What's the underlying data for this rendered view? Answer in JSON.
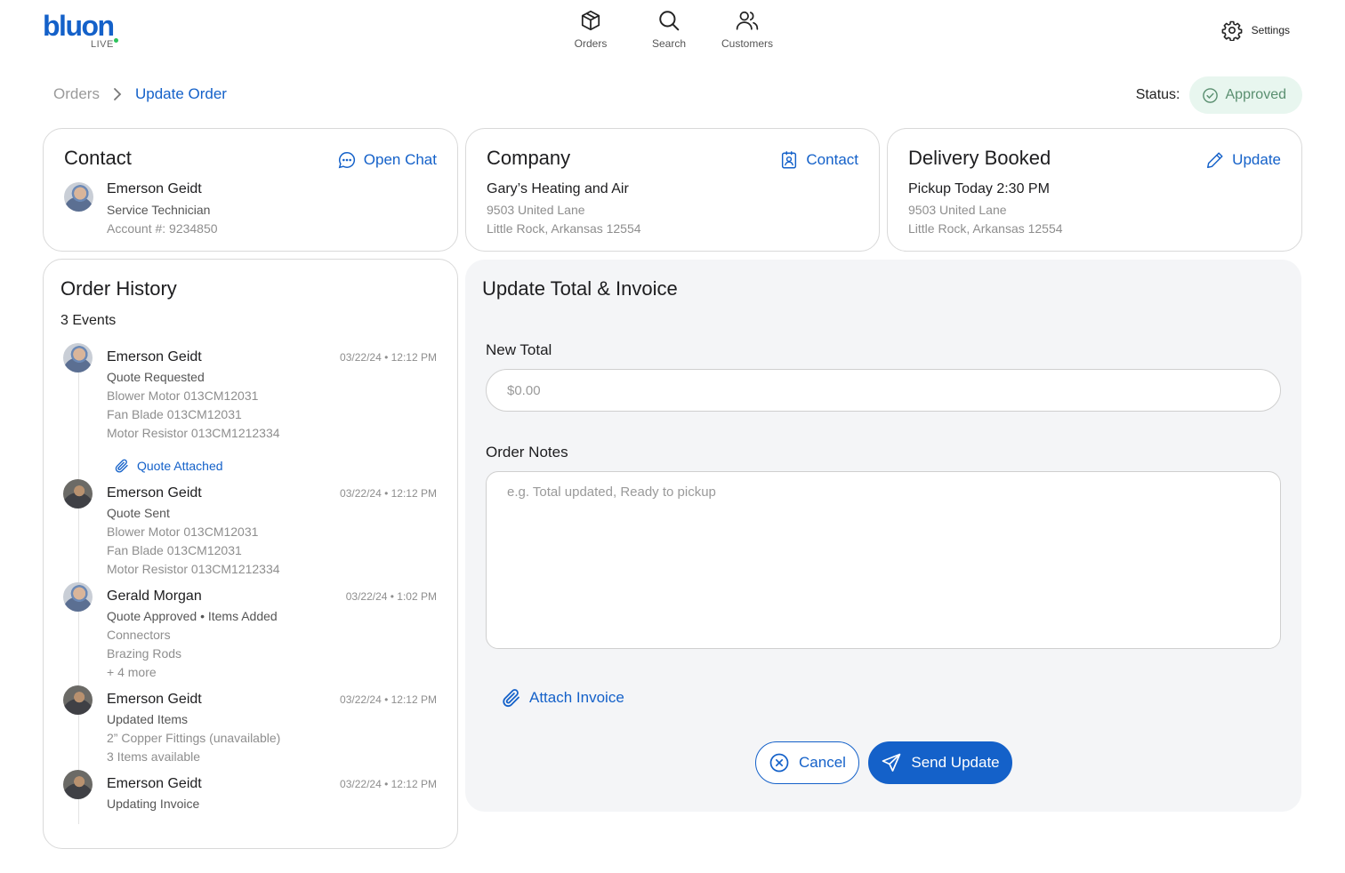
{
  "brand": {
    "name": "bluon",
    "sub": "LIVE",
    "accent": "#1461c9",
    "dot_color": "#2dc25b"
  },
  "nav": [
    {
      "label": "Orders",
      "icon": "box-icon"
    },
    {
      "label": "Search",
      "icon": "search-icon"
    },
    {
      "label": "Customers",
      "icon": "users-icon"
    }
  ],
  "settings": {
    "label": "Settings",
    "icon": "gear-icon"
  },
  "breadcrumb": {
    "root": "Orders",
    "current": "Update Order"
  },
  "status": {
    "label": "Status:",
    "value": "Approved",
    "bg": "#e8f6ef",
    "color": "#5a8f70"
  },
  "contact": {
    "title": "Contact",
    "action": "Open Chat",
    "name": "Emerson Geidt",
    "role": "Service Technician",
    "account": "Account #: 9234850"
  },
  "company": {
    "title": "Company",
    "action": "Contact",
    "name": "Gary’s Heating and Air",
    "address1": "9503 United Lane",
    "address2": "Little Rock, Arkansas 12554"
  },
  "delivery": {
    "title": "Delivery Booked",
    "action": "Update",
    "pickup": "Pickup Today 2:30 PM",
    "address1": "9503 United Lane",
    "address2": "Little Rock, Arkansas 12554"
  },
  "history": {
    "title": "Order History",
    "count": "3 Events",
    "events": [
      {
        "name": "Emerson Geidt",
        "time": "03/22/24 • 12:12 PM",
        "type": "Quote Requested",
        "details": [
          "Blower Motor 013CM12031",
          "Fan Blade 013CM12031",
          "Motor Resistor 013CM1212334"
        ],
        "attachment": "Quote Attached"
      },
      {
        "name": "Emerson Geidt",
        "time": "03/22/24 • 12:12 PM",
        "type": "Quote Sent",
        "details": [
          "Blower Motor 013CM12031",
          "Fan Blade 013CM12031",
          "Motor Resistor 013CM1212334"
        ]
      },
      {
        "name": "Gerald Morgan",
        "time": "03/22/24 • 1:02 PM",
        "type": "Quote Approved • Items Added",
        "details": [
          "Connectors",
          "Brazing Rods",
          "+ 4 more"
        ]
      },
      {
        "name": "Emerson Geidt",
        "time": "03/22/24 • 12:12 PM",
        "type": "Updated Items",
        "details": [
          "2” Copper Fittings (unavailable)",
          "3 Items available"
        ]
      },
      {
        "name": "Emerson Geidt",
        "time": "03/22/24 • 12:12 PM",
        "type": "Updating Invoice",
        "details": []
      }
    ]
  },
  "update_panel": {
    "title": "Update Total & Invoice",
    "total_label": "New Total",
    "total_placeholder": "$0.00",
    "notes_label": "Order Notes",
    "notes_placeholder": "e.g. Total updated, Ready to pickup",
    "attach": "Attach Invoice",
    "cancel": "Cancel",
    "send": "Send Update"
  }
}
